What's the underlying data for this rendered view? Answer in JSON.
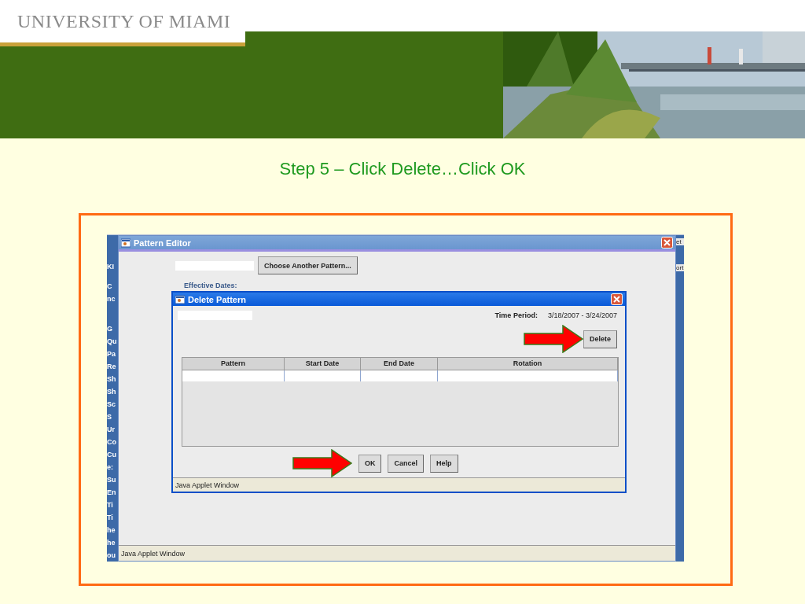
{
  "slide": {
    "logo": "UNIVERSITY OF MIAMI",
    "title": "Step 5 – Click Delete…Click OK"
  },
  "background_app": {
    "left_fragments": [
      "KI",
      "C",
      "nc",
      "G",
      "Qu",
      "Pa",
      "Re",
      "Sh",
      "Sh",
      "Sc",
      "S",
      "Ur",
      "Co",
      "Cu",
      "e:",
      "Su",
      "En",
      "Ti",
      "Ti",
      "he",
      "he",
      "ou"
    ],
    "right_fragments": [
      "et",
      "ort"
    ]
  },
  "pattern_editor": {
    "title": "Pattern Editor",
    "choose_button": "Choose Another Pattern...",
    "effective_dates_label": "Effective Dates:",
    "status": "Java Applet Window"
  },
  "delete_dialog": {
    "title": "Delete Pattern",
    "time_period_label": "Time Period:",
    "time_period_value": "3/18/2007 - 3/24/2007",
    "delete_button": "Delete",
    "columns": [
      "Pattern",
      "Start Date",
      "End Date",
      "Rotation"
    ],
    "buttons": [
      "OK",
      "Cancel",
      "Help"
    ],
    "status": "Java Applet Window"
  }
}
